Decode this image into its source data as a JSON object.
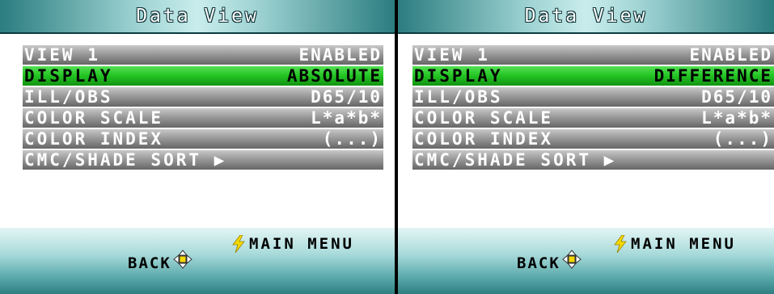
{
  "screens": [
    {
      "title": "Data View",
      "rows": [
        {
          "label": "VIEW 1",
          "value": "ENABLED"
        },
        {
          "label": "DISPLAY",
          "value": "ABSOLUTE"
        },
        {
          "label": "ILL/OBS",
          "value": "D65/10"
        },
        {
          "label": "COLOR SCALE",
          "value": "L*a*b*"
        },
        {
          "label": "COLOR INDEX",
          "value": "(...)"
        },
        {
          "label": "CMC/SHADE SORT ▶",
          "value": ""
        }
      ],
      "selected_row": "DISPLAY",
      "main_menu_label": "MAIN MENU",
      "back_label": "BACK"
    },
    {
      "title": "Data View",
      "rows": [
        {
          "label": "VIEW 1",
          "value": "ENABLED"
        },
        {
          "label": "DISPLAY",
          "value": "DIFFERENCE"
        },
        {
          "label": "ILL/OBS",
          "value": "D65/10"
        },
        {
          "label": "COLOR SCALE",
          "value": "L*a*b*"
        },
        {
          "label": "COLOR INDEX",
          "value": "(...)"
        },
        {
          "label": "CMC/SHADE SORT ▶",
          "value": ""
        }
      ],
      "selected_row": "DISPLAY",
      "main_menu_label": "MAIN MENU",
      "back_label": "BACK"
    }
  ],
  "icons": {
    "main_menu": "lightning-bolt-icon",
    "back": "dpad-arrows-icon"
  },
  "colors": {
    "selected_row": "#22c322",
    "row_gray": "#9a9a9a",
    "title_teal": "#2b7d80"
  }
}
